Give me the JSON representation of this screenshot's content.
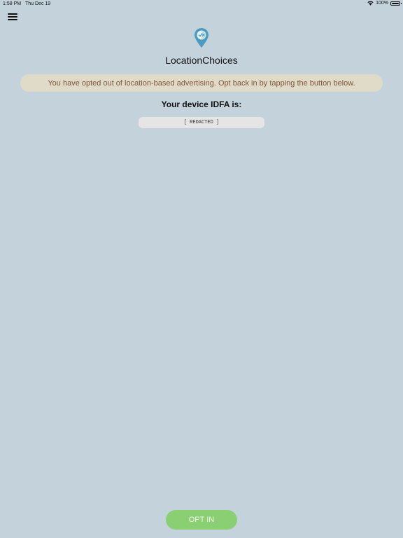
{
  "status_bar": {
    "time": "1:58 PM",
    "date": "Thu Dec 19",
    "battery": "100%",
    "wifi_icon": "wifi-icon",
    "battery_icon": "battery-icon"
  },
  "header": {
    "menu_icon": "hamburger-menu-icon",
    "logo_icon": "location-pin-icon",
    "title": "LocationChoices"
  },
  "notice": {
    "text": "You have opted out of location-based advertising. Opt back in by tapping the button below."
  },
  "idfa": {
    "label": "Your device IDFA is:",
    "value": "[ REDACTED ]"
  },
  "actions": {
    "opt_in_label": "OPT IN"
  },
  "colors": {
    "background": "#c4d2dc",
    "banner_bg": "#dfdbc8",
    "banner_text": "#80563b",
    "button_bg": "#8acf72",
    "pin_blue": "#4a9bbd"
  }
}
